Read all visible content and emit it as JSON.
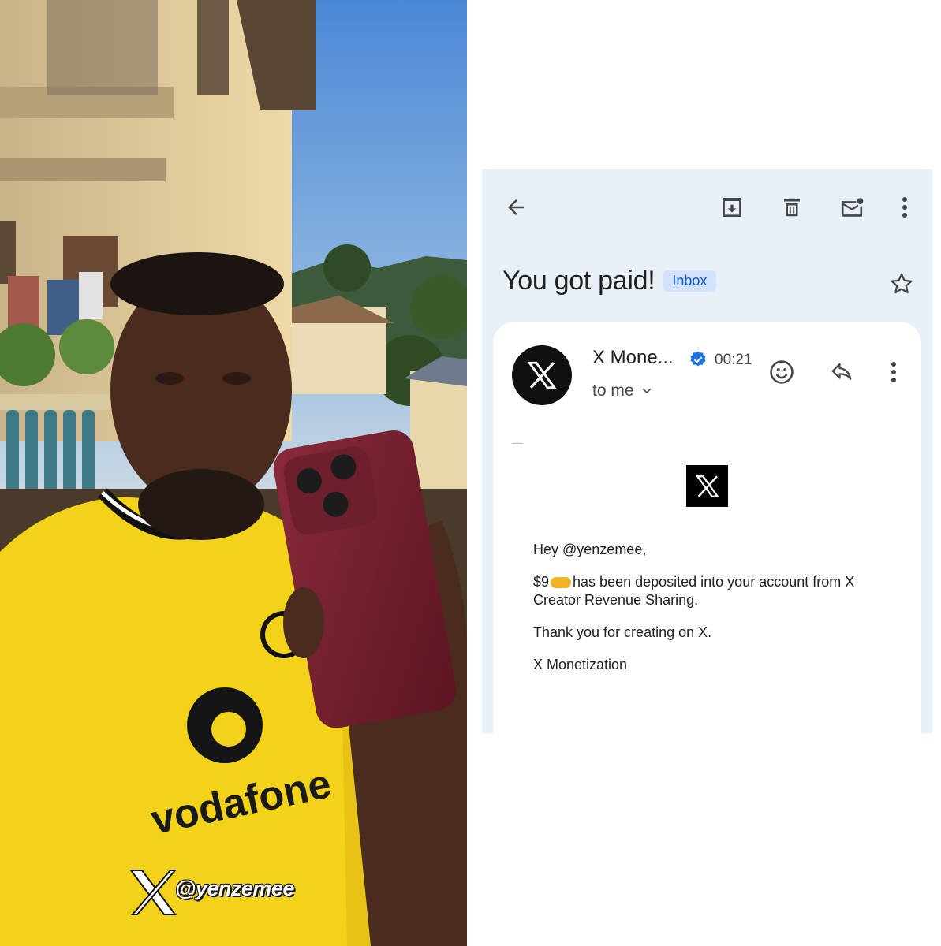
{
  "watermark": {
    "handle": "@yenzemee"
  },
  "photo": {
    "jersey_sponsor": "vodafone"
  },
  "email": {
    "toolbar": {
      "back_icon": "arrow-left-icon",
      "archive_icon": "archive-icon",
      "delete_icon": "trash-icon",
      "mark_unread_icon": "mail-unread-icon",
      "more_icon": "more-vert-icon"
    },
    "subject": "You got paid!",
    "label": "Inbox",
    "sender": {
      "name": "X Mone...",
      "time": "00:21",
      "recipient": "to me",
      "avatar_icon": "x-logo-icon"
    },
    "body": {
      "greeting": "Hey @yenzemee,",
      "amount_prefix": "$9",
      "amount_suffix": "has been deposited into your account from X Creator Revenue Sharing.",
      "thanks": "Thank you for creating on X.",
      "signature": "X Monetization"
    },
    "colors": {
      "background": "#eaf0f7",
      "badge_bg": "#d3e3fd",
      "badge_text": "#0b57d0",
      "verified": "#1a73e8"
    }
  }
}
